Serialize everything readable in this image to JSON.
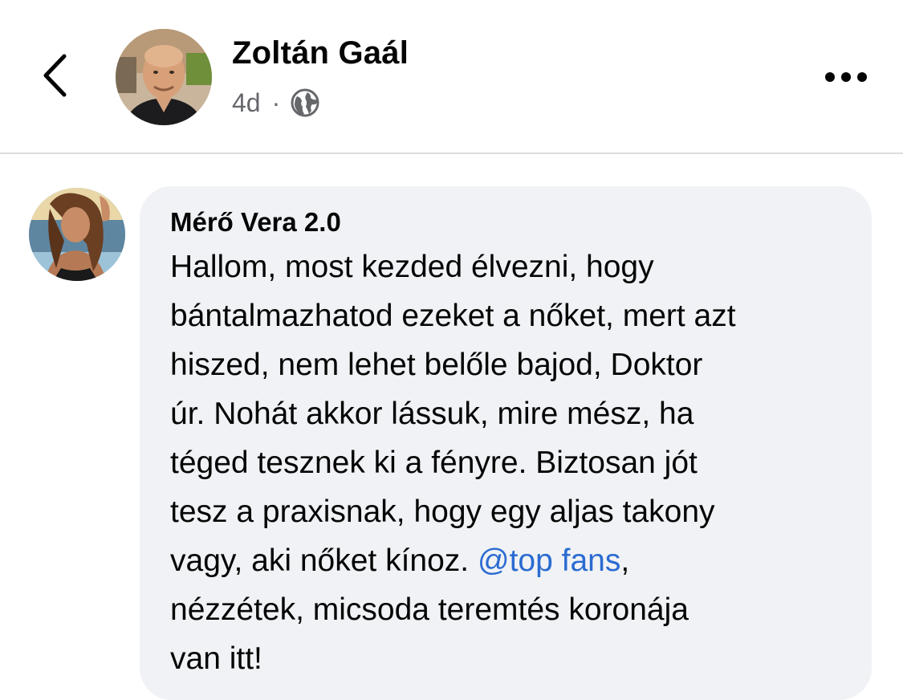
{
  "header": {
    "author_name": "Zoltán Gaál",
    "time_ago": "4d",
    "separator": "·",
    "audience_icon": "globe-icon",
    "back_icon": "chevron-left-icon",
    "more_icon": "more-horizontal-icon"
  },
  "comment": {
    "author_name": "Mérő Vera 2.0",
    "lines": [
      "Hallom, most kezded élvezni, hogy",
      "bántalmazhatod ezeket a nőket, mert azt",
      "hiszed, nem lehet belőle bajod, Doktor",
      "úr. Nohát akkor lássuk, mire mész, ha",
      "téged tesznek ki a fényre. Biztosan jót",
      "tesz a praxisnak, hogy egy aljas takony"
    ],
    "line7_before": "vagy, aki nőket kínoz. ",
    "mention": "@top fans",
    "line7_after": ",",
    "line8": "nézzétek, micsoda teremtés koronája",
    "line9": "van itt!"
  },
  "colors": {
    "bubble_bg": "#f0f2f5",
    "mention": "#2a6bd1",
    "meta_text": "#65676b"
  }
}
